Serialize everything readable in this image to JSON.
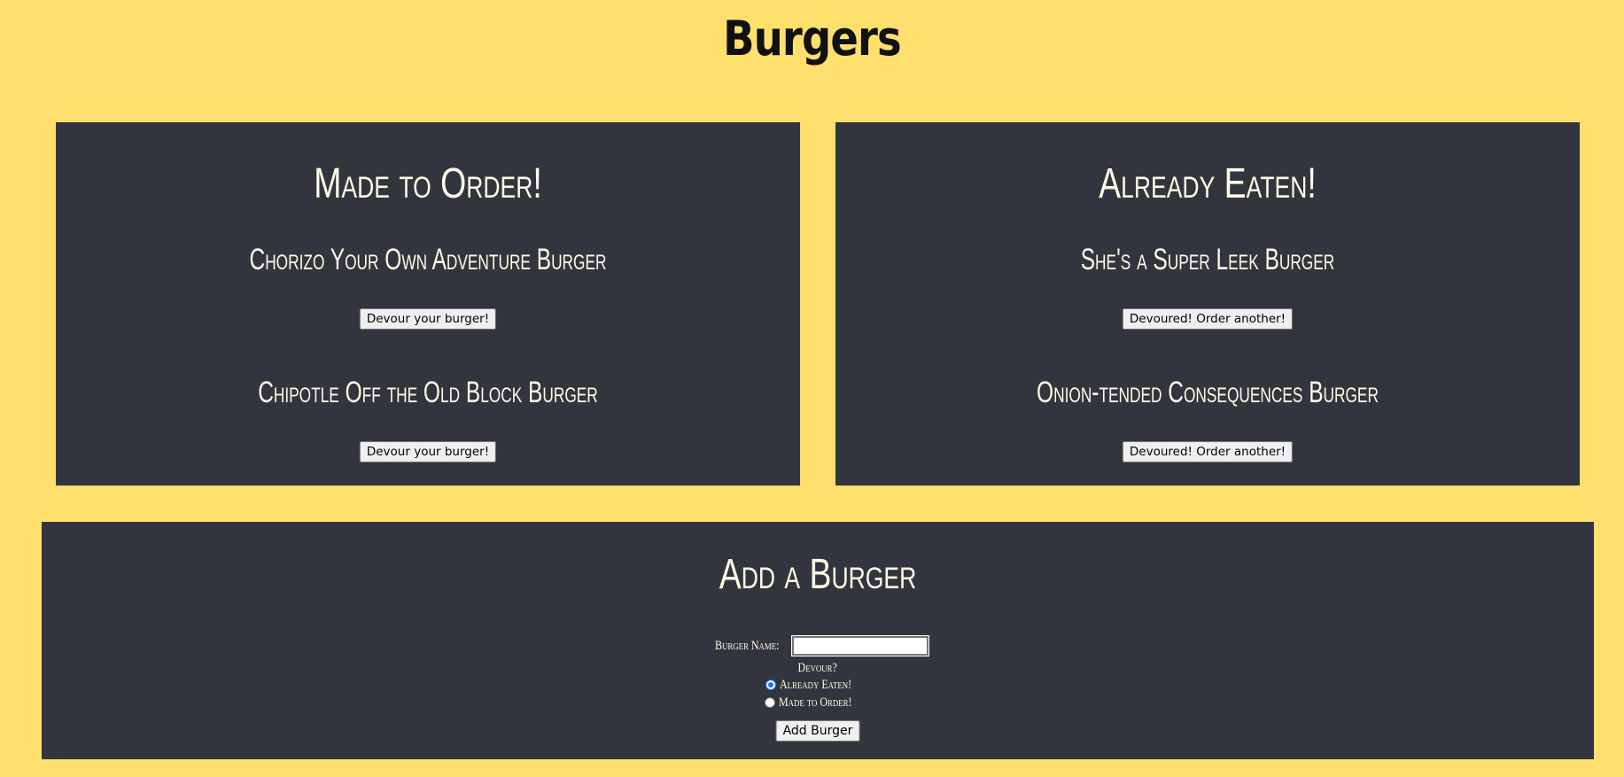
{
  "page": {
    "title": "Burgers"
  },
  "made_to_order": {
    "heading": "Made to Order!",
    "burgers": [
      {
        "name": "Chorizo Your Own Adventure Burger",
        "button_label": "Devour your burger!"
      },
      {
        "name": "Chipotle Off the Old Block Burger",
        "button_label": "Devour your burger!"
      }
    ]
  },
  "already_eaten": {
    "heading": "Already Eaten!",
    "burgers": [
      {
        "name": "She's a Super Leek Burger",
        "button_label": "Devoured! Order another!"
      },
      {
        "name": "Onion-tended Consequences Burger",
        "button_label": "Devoured! Order another!"
      }
    ]
  },
  "add_form": {
    "heading": "Add a Burger",
    "name_label": "Burger Name:",
    "name_value": "",
    "devour_label": "Devour?",
    "options": [
      {
        "label": "Already Eaten!",
        "checked": true
      },
      {
        "label": "Made to Order!",
        "checked": false
      }
    ],
    "submit_label": "Add Burger"
  },
  "colors": {
    "background": "#ffdf6d",
    "panel": "#32353d",
    "panel_text": "#fffbe6",
    "radio_accent": "#1a73e8"
  }
}
